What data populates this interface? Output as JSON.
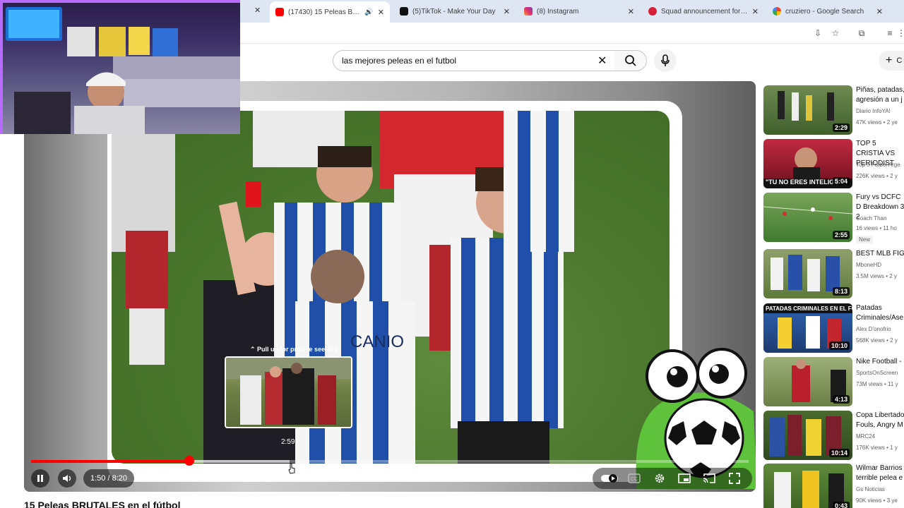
{
  "browser": {
    "tabs": [
      {
        "title": "(17430) 15 Peleas BRUTALE",
        "favicon": "youtube-favicon",
        "audio": true,
        "active": true
      },
      {
        "title": "(5)TikTok - Make Your Day",
        "favicon": "tiktok-favicon"
      },
      {
        "title": "(8) Instagram",
        "favicon": "instagram-favicon"
      },
      {
        "title": "Squad announcement for the m",
        "favicon": "squad-favicon"
      },
      {
        "title": "cruziero - Google Search",
        "favicon": "google-favicon"
      }
    ]
  },
  "search": {
    "query": "las mejores peleas en el futbol"
  },
  "header": {
    "create_label": "C"
  },
  "player": {
    "time_display": "1:50 / 8:20",
    "progress_fraction": 0.22,
    "buffer_fraction": 0.36,
    "seek_hint": "⌃ Pull up for precise seeking",
    "preview_time": "2:59",
    "jersey_text": "CANIO"
  },
  "video": {
    "title": "15 Peleas BRUTALES en el fútbol"
  },
  "sidebar": {
    "items": [
      {
        "title": "Piñas, patadas, agresión a un j",
        "channel": "Diario InfoYA!",
        "stats": "47K views • 2 ye",
        "duration": "2:29"
      },
      {
        "title": "TOP 5 CRISTIA VS PERIODIST",
        "channel": "Top 5 Futbol Arge",
        "stats": "226K views • 2 y",
        "duration": "5:04",
        "thumb_text": "\"TU NO ERES INTELIGE"
      },
      {
        "title": "Fury vs DCFC D Breakdown 3 2",
        "channel": "Coach Than",
        "stats": "16 views • 11 ho",
        "duration": "2:55",
        "badge": "New"
      },
      {
        "title": "BEST MLB FIG",
        "channel": "MboneHD",
        "stats": "3.5M views • 2 y",
        "duration": "8:13"
      },
      {
        "title": "Patadas Criminales/Ase",
        "channel": "Alex D'onofrio",
        "stats": "568K views • 2 y",
        "duration": "10:10",
        "thumb_text": "PATADAS CRIMINALES EN EL FUTBOL"
      },
      {
        "title": "Nike Football -",
        "channel": "SportsOnScreen",
        "stats": "73M views • 11 y",
        "duration": "4:13"
      },
      {
        "title": "Copa Libertado Fouls, Angry M",
        "channel": "MRC24",
        "stats": "176K views • 1 y",
        "duration": "10:14"
      },
      {
        "title": "Wilmar Barrios terrible pelea e",
        "channel": "Gs Noticias",
        "stats": "90K views • 3 ye",
        "duration": "0:43"
      }
    ]
  },
  "colors": {
    "accent_red": "#ff0000",
    "tab_strip": "#dfe6f3"
  }
}
